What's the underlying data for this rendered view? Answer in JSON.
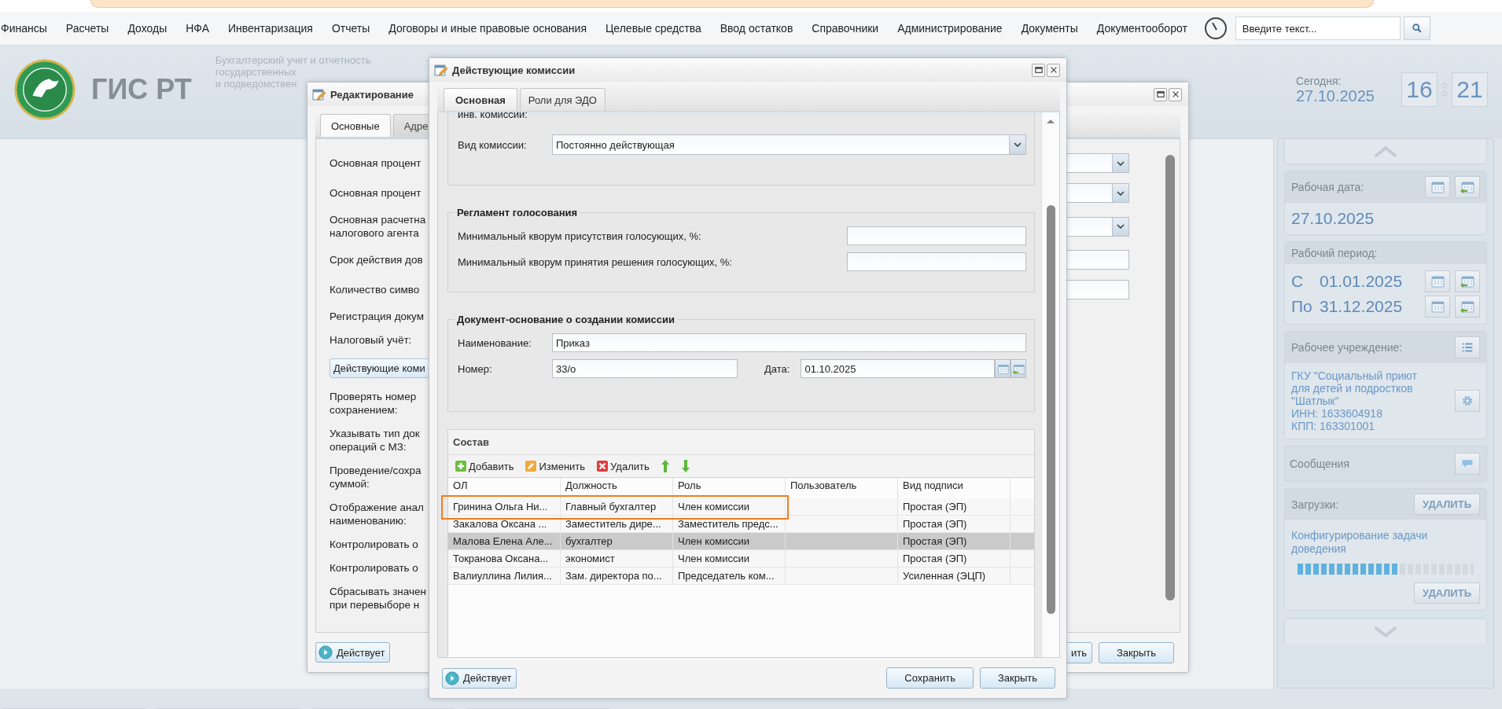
{
  "top_menu": {
    "items": [
      "Финансы",
      "Расчеты",
      "Доходы",
      "НФА",
      "Инвентаризация",
      "Отчеты",
      "Договоры и иные правовые основания",
      "Целевые средства",
      "Ввод остатков",
      "Справочники",
      "Администрирование",
      "Документы",
      "Документооборот"
    ],
    "search": {
      "placeholder": "Введите текст..."
    }
  },
  "header": {
    "title": "ГИС РТ",
    "subtitle": [
      "Бухгалтерский учет и отчетность",
      "государственных",
      "и подведомствен"
    ],
    "today_label": "Сегодня:",
    "today": "27.10.2025",
    "hours": "16",
    "minutes": "21"
  },
  "sidebar": {
    "work_date": {
      "label": "Рабочая дата:",
      "value": "27.10.2025"
    },
    "work_period": {
      "label": "Рабочий период:",
      "rows": [
        {
          "prefix": "С",
          "date": "01.01.2025"
        },
        {
          "prefix": "По",
          "date": "31.12.2025"
        }
      ]
    },
    "institution": {
      "label": "Рабочее учреждение:",
      "text": "ГКУ \"Социальный приют\nдля детей и подростков\n\"Шатлык\"\nИНН: 1633604918\nКПП: 163301001"
    },
    "messages": {
      "label": "Сообщения"
    },
    "downloads": {
      "label": "Загрузки:",
      "clear_button": "УДАЛИТЬ",
      "task": "Конфигурирование задачи\nдоведения",
      "level": 0.57,
      "delete_button": "УДАЛИТЬ"
    }
  },
  "edit_window": {
    "title": "Редактирование",
    "tabs": [
      {
        "label": "Основные",
        "selected": true
      },
      {
        "label": "Адре",
        "selected": false
      }
    ],
    "fields": [
      {
        "kind": "combo",
        "label": "Основная процент"
      },
      {
        "kind": "combo",
        "label": "Основная процент"
      },
      {
        "kind": "combo",
        "label": "Основная расчетна\nналогового агента"
      },
      {
        "kind": "input",
        "label": "Срок действия дов"
      },
      {
        "kind": "input",
        "label": "Количество симво"
      },
      {
        "kind": "text",
        "label": "Регистрация докум"
      },
      {
        "kind": "text",
        "label": "Налоговый учёт:"
      },
      {
        "kind": "button",
        "label": "Действующие коми"
      },
      {
        "kind": "text",
        "label": "Проверять номер\nсохранением:"
      },
      {
        "kind": "text",
        "label": "Указывать тип док\nопераций с МЗ:"
      },
      {
        "kind": "text",
        "label": "Проведение/сохра\nсуммой:"
      },
      {
        "kind": "text",
        "label": "Отображение анал\nнаименованию:"
      },
      {
        "kind": "text",
        "label": "Контролировать о"
      },
      {
        "kind": "text",
        "label": "Контролировать о"
      },
      {
        "kind": "text",
        "label": "Сбрасывать значен\nпри перевыборе н"
      }
    ],
    "status_button": "Действует",
    "buttons": [
      "ить",
      "Закрыть"
    ]
  },
  "dialog": {
    "title": "Действующие комиссии",
    "tabs": [
      {
        "label": "Основная",
        "selected": true
      },
      {
        "label": "Роли для ЭДО",
        "selected": false
      }
    ],
    "commission": {
      "cut_label": "инв. комиссии:",
      "type_label": "Вид комиссии:",
      "type_value": "Постоянно действующая"
    },
    "voting": {
      "title": "Регламент голосования",
      "fields": [
        {
          "label": "Минимальный кворум присутствия голосующих, %:"
        },
        {
          "label": "Минимальный кворум принятия решения голосующих, %:"
        }
      ]
    },
    "basis": {
      "title": "Документ-основание о создании комиссии",
      "name_label": "Наименование:",
      "name_value": "Приказ",
      "number_label": "Номер:",
      "number_value": "33/о",
      "date_label": "Дата:",
      "date_value": "01.10.2025"
    },
    "members": {
      "title": "Состав",
      "toolbar": [
        {
          "kind": "add",
          "label": "Добавить"
        },
        {
          "kind": "edit",
          "label": "Изменить"
        },
        {
          "kind": "delete",
          "label": "Удалить"
        },
        {
          "kind": "up"
        },
        {
          "kind": "down"
        }
      ],
      "columns": [
        "ОЛ",
        "Должность",
        "Роль",
        "Пользователь",
        "Вид подписи"
      ],
      "rows": [
        {
          "person": "Гринина Ольга Ни...",
          "position": "Главный бухгалтер",
          "role": "Член комиссии",
          "signature": "Простая (ЭП)",
          "selected": false,
          "highlighted": true
        },
        {
          "person": "Закалова Оксана ...",
          "position": "Заместитель дире...",
          "role": "Заместитель предс...",
          "signature": "Простая (ЭП)",
          "selected": false,
          "highlighted": false
        },
        {
          "person": "Малова Елена Але...",
          "position": "бухгалтер",
          "role": "Член комиссии",
          "signature": "Простая (ЭП)",
          "selected": true,
          "highlighted": false
        },
        {
          "person": "Токранова Оксана...",
          "position": "экономист",
          "role": "Член комиссии",
          "signature": "Простая (ЭП)",
          "selected": false,
          "highlighted": false
        },
        {
          "person": "Валиуллина Лилия...",
          "position": "Зам. директора по...",
          "role": "Председатель ком...",
          "signature": "Усиленная (ЭЦП)",
          "selected": false,
          "highlighted": false
        }
      ]
    },
    "status_button": "Действует",
    "buttons": [
      "Сохранить",
      "Закрыть"
    ]
  }
}
